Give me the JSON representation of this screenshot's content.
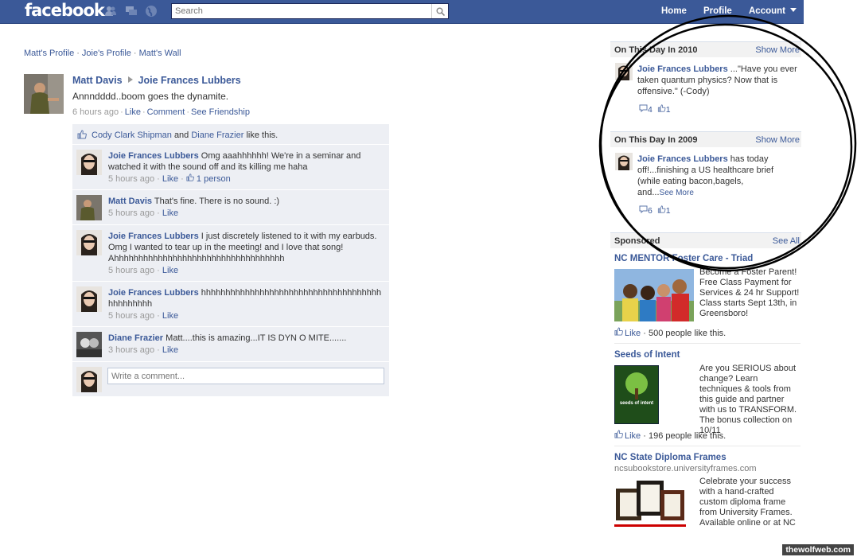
{
  "header": {
    "logo": "facebook",
    "search_placeholder": "Search",
    "nav": {
      "home": "Home",
      "profile": "Profile",
      "account": "Account"
    }
  },
  "breadcrumbs": [
    "Matt's Profile",
    "Joie's Profile",
    "Matt's Wall"
  ],
  "story": {
    "actor": "Matt Davis",
    "target": "Joie Frances Lubbers",
    "text": "Annndddd..boom goes the dynamite.",
    "time": "6 hours ago",
    "actions": [
      "Like",
      "Comment",
      "See Friendship"
    ]
  },
  "likes": {
    "person1": "Cody Clark Shipman",
    "and": "and",
    "person2": "Diane Frazier",
    "suffix": "like this."
  },
  "comments": [
    {
      "name": "Joie Frances Lubbers",
      "text": "Omg aaahhhhhh! We're in a seminar and watched it with the sound off and its killing me haha",
      "time": "5 hours ago",
      "like": "Like",
      "likes_count": "1 person"
    },
    {
      "name": "Matt Davis",
      "text": "That's fine. There is no sound. :)",
      "time": "5 hours ago",
      "like": "Like"
    },
    {
      "name": "Joie Frances Lubbers",
      "text": "I just discretely listened to it with my earbuds. Omg I wanted to tear up in the meeting! and I love that song! Ahhhhhhhhhhhhhhhhhhhhhhhhhhhhhhhhhhh",
      "time": "5 hours ago",
      "like": "Like"
    },
    {
      "name": "Joie Frances Lubbers",
      "text": "hhhhhhhhhhhhhhhhhhhhhhhhhhhhhhhhhhhhhhhhhhhhhh",
      "time": "5 hours ago",
      "like": "Like"
    },
    {
      "name": "Diane Frazier",
      "text": "Matt....this is amazing...IT IS DYN O MITE.......",
      "time": "3 hours ago",
      "like": "Like"
    }
  ],
  "write_comment_placeholder": "Write a comment...",
  "on_this_day": [
    {
      "title": "On This Day In 2010",
      "more": "Show More",
      "name": "Joie Frances Lubbers",
      "text": "...\"Have you ever taken quantum physics? Now that is offensive.\" (-Cody)",
      "comments": "4",
      "likes": "1"
    },
    {
      "title": "On This Day In 2009",
      "more": "Show More",
      "name": "Joie Frances Lubbers",
      "text": "has today off!...finishing a US healthcare brief (while eating bacon,bagels, and...",
      "see_more": "See More",
      "comments": "6",
      "likes": "1"
    }
  ],
  "sponsored": {
    "title": "Sponsored",
    "see_all": "See All",
    "ads": [
      {
        "title": "NC MENTOR Foster Care - Triad",
        "text": "Become a Foster Parent! Free Class Payment for Services & 24 hr Support! Class starts Sept 13th, in Greensboro!",
        "like": "Like",
        "count": "500 people like this."
      },
      {
        "title": "Seeds of Intent",
        "text": "Are you SERIOUS about change? Learn techniques & tools from this guide and partner with us to TRANSFORM. The bonus collection on 10/11",
        "like": "Like",
        "count": "196 people like this.",
        "book_label": "seeds of intent"
      },
      {
        "title": "NC State Diploma Frames",
        "domain": "ncsubookstore.universityframes.com",
        "text": "Celebrate your success with a hand-crafted custom diploma frame from University Frames. Available online or at NC"
      }
    ]
  },
  "watermark": "thewolfweb.com",
  "colors": {
    "brand": "#3b5998",
    "ufi_bg": "#edeff4",
    "link": "#3b5998"
  }
}
